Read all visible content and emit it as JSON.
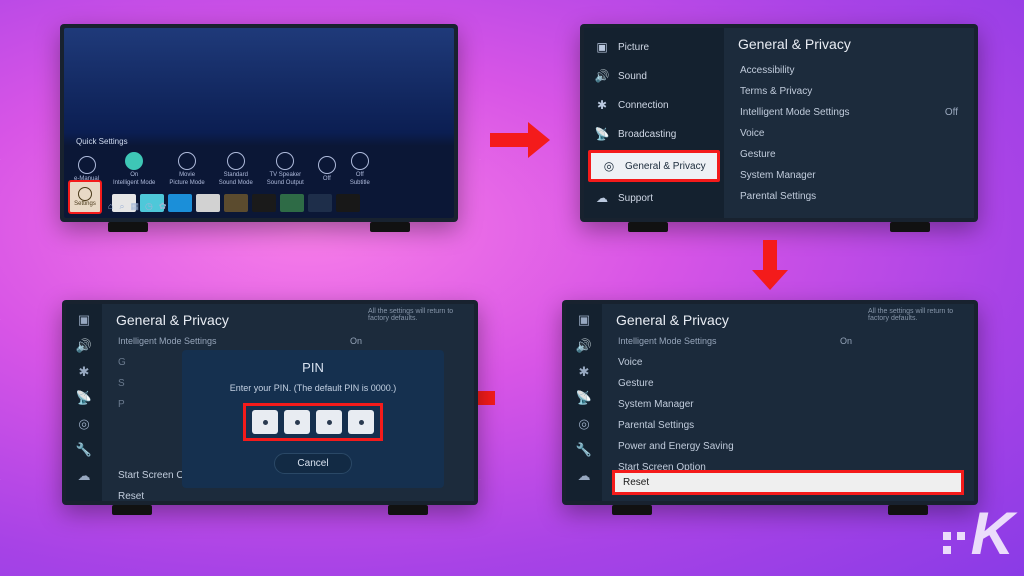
{
  "tv1": {
    "quick_settings_label": "Quick Settings",
    "settings_label": "Settings",
    "items": [
      {
        "label": "e-Manual",
        "sub": ""
      },
      {
        "label": "On",
        "sub": "Intelligent Mode"
      },
      {
        "label": "Movie",
        "sub": "Picture Mode"
      },
      {
        "label": "Standard",
        "sub": "Sound Mode"
      },
      {
        "label": "TV Speaker",
        "sub": "Sound Output"
      },
      {
        "label": "Off",
        "sub": ""
      },
      {
        "label": "Off",
        "sub": "Subtitle"
      }
    ]
  },
  "tv2": {
    "sidebar": [
      {
        "icon": "picture",
        "label": "Picture"
      },
      {
        "icon": "sound",
        "label": "Sound"
      },
      {
        "icon": "connection",
        "label": "Connection"
      },
      {
        "icon": "broadcasting",
        "label": "Broadcasting"
      },
      {
        "icon": "general",
        "label": "General & Privacy"
      },
      {
        "icon": "support",
        "label": "Support"
      }
    ],
    "title": "General & Privacy",
    "menu": [
      {
        "label": "Accessibility",
        "value": ""
      },
      {
        "label": "Terms & Privacy",
        "value": ""
      },
      {
        "label": "Intelligent Mode Settings",
        "value": "Off"
      },
      {
        "label": "Voice",
        "value": ""
      },
      {
        "label": "Gesture",
        "value": ""
      },
      {
        "label": "System Manager",
        "value": ""
      },
      {
        "label": "Parental Settings",
        "value": ""
      }
    ]
  },
  "tv3": {
    "title": "General & Privacy",
    "subhead_label": "Intelligent Mode Settings",
    "subhead_value": "On",
    "menu": [
      {
        "label": "Voice"
      },
      {
        "label": "Gesture"
      },
      {
        "label": "System Manager"
      },
      {
        "label": "Parental Settings"
      },
      {
        "label": "Power and Energy Saving"
      },
      {
        "label": "Start Screen Option"
      }
    ],
    "reset_label": "Reset",
    "info_text": "All the settings will return to factory defaults."
  },
  "tv4": {
    "title": "General & Privacy",
    "subhead_label": "Intelligent Mode Settings",
    "subhead_value": "On",
    "row_g": "G",
    "row_s": "S",
    "row_p": "P",
    "row_start": "Start Screen Option",
    "row_reset": "Reset",
    "dialog_title": "PIN",
    "dialog_hint": "Enter your PIN. (The default PIN is 0000.)",
    "cancel_label": "Cancel",
    "info_text": "All the settings will return to factory defaults."
  },
  "watermark": "K"
}
